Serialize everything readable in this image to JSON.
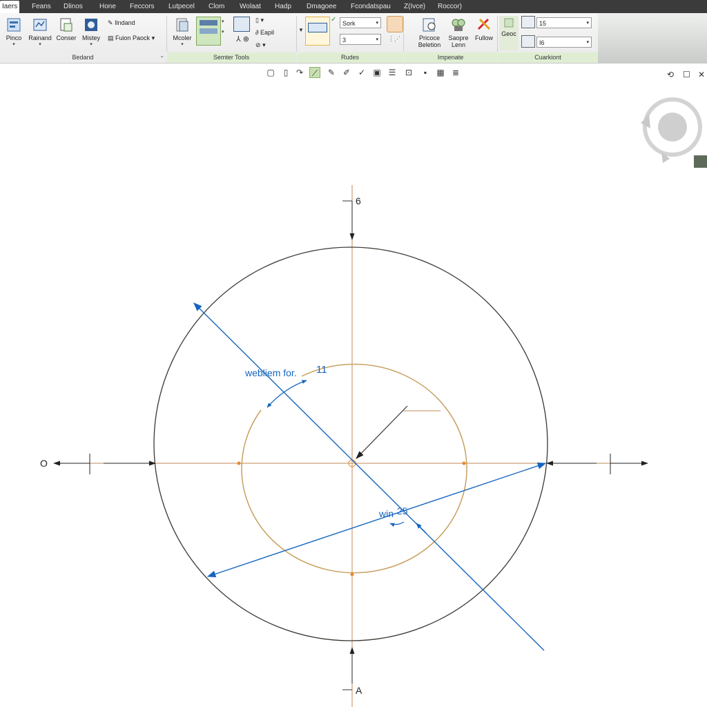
{
  "tabs": [
    "Iaers",
    "Feans",
    "Dlinos",
    "Hone",
    "Feccors",
    "Lutpecel",
    "Clom",
    "Wolaat",
    "Hadp",
    "Dmagoee",
    "Fcondatspau",
    "Z(Ivce)",
    "Roccor)"
  ],
  "ribbon": {
    "groups": [
      {
        "label": "Bedand",
        "color": "plain"
      },
      {
        "label": "Semter Tools",
        "color": "green"
      },
      {
        "label": "Rudes",
        "color": "green"
      },
      {
        "label": "Impenate",
        "color": "green"
      },
      {
        "label": "Cuarkiont",
        "color": "green"
      }
    ],
    "buttons": {
      "pinco": "Pinco",
      "rainand": "Rainand",
      "conser": "Conser",
      "mistey": "Mistey",
      "landand": "Ilndand",
      "ruion_paock": "Fuion Paock",
      "mcoler": "Mcoler",
      "eapil": "Eapil",
      "pricoce": "Pricoce",
      "beletion": "Beletion",
      "saopre": "Saopre",
      "lenn": "Lenn",
      "fullow": "Fullow",
      "geoc": "Geoc"
    },
    "combos": {
      "sork": "Sork",
      "three": "3",
      "val_top": "15",
      "val_bottom": "I6"
    }
  },
  "drawing": {
    "label_top": "6",
    "label_bottom": "A",
    "label_left": "O",
    "annotation_1": "webliem for.",
    "annotation_1_value": "11",
    "annotation_2": "win",
    "annotation_2_value": "25"
  },
  "colors": {
    "accent_blue": "#1565c0",
    "axis_line": "#c08a5a",
    "inner_circle": "#c8a060",
    "outer_circle": "#3a3530",
    "tab_bar": "#3b3b3b",
    "group_green": "#dfeed3"
  },
  "icons": [
    "nav-cube-orbit-icon",
    "close-icon",
    "restore-icon",
    "pin-icon"
  ]
}
